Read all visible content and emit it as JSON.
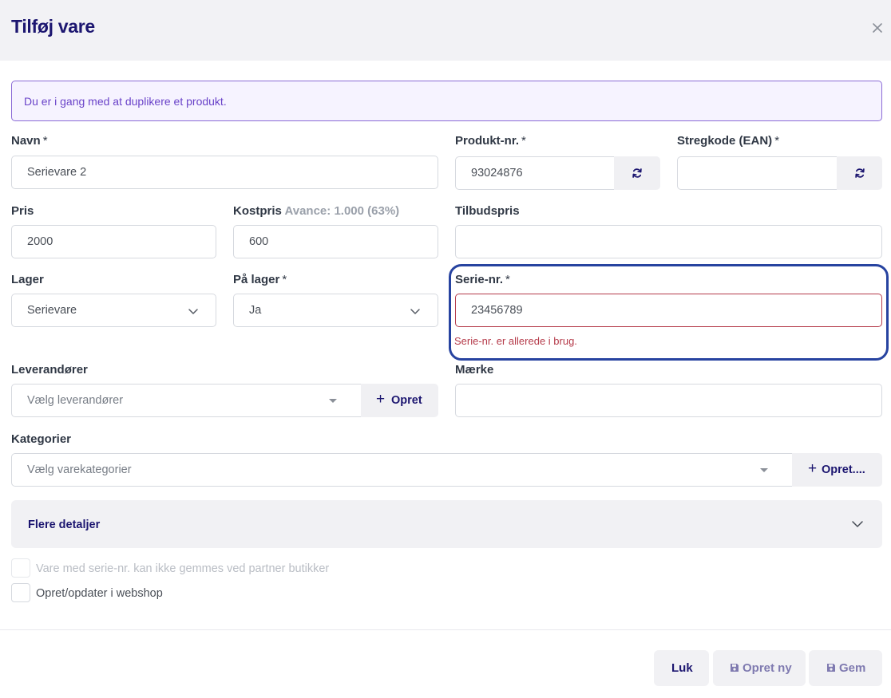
{
  "header": {
    "title": "Tilføj vare",
    "close_icon": "close-icon"
  },
  "banner": {
    "text": "Du er i gang med at duplikere et produkt."
  },
  "fields": {
    "navn": {
      "label": "Navn",
      "required": "*",
      "value": "Serievare 2"
    },
    "produkt_nr": {
      "label": "Produkt-nr.",
      "required": "*",
      "value": "93024876",
      "icon": "refresh-icon"
    },
    "stregkode": {
      "label": "Stregkode (EAN)",
      "required": "*",
      "value": "",
      "icon": "refresh-icon"
    },
    "pris": {
      "label": "Pris",
      "value": "2000"
    },
    "kostpris": {
      "label": "Kostpris",
      "hint": "Avance: 1.000 (63%)",
      "value": "600"
    },
    "tilbudspris": {
      "label": "Tilbudspris",
      "value": ""
    },
    "lager": {
      "label": "Lager",
      "value": "Serievare"
    },
    "paa_lager": {
      "label": "På lager",
      "required": "*",
      "value": "Ja"
    },
    "serie_nr": {
      "label": "Serie-nr.",
      "required": "*",
      "value": "23456789",
      "error": "Serie-nr. er allerede i brug."
    },
    "leverandoerer": {
      "label": "Leverandører",
      "placeholder": "Vælg leverandører",
      "button": "Opret"
    },
    "maerke": {
      "label": "Mærke",
      "value": ""
    },
    "kategorier": {
      "label": "Kategorier",
      "placeholder": "Vælg varekategorier",
      "button": "Opret...."
    }
  },
  "details": {
    "label": "Flere detaljer"
  },
  "checkboxes": {
    "serie_partner": {
      "label": "Vare med serie-nr. kan ikke gemmes ved partner butikker",
      "checked": false,
      "disabled": true
    },
    "webshop": {
      "label": "Opret/opdater i webshop",
      "checked": false,
      "disabled": false
    }
  },
  "footer": {
    "luk": "Luk",
    "opret_ny": "Opret ny",
    "gem": "Gem"
  },
  "colors": {
    "brand": "#1c1670",
    "error": "#b53b4a",
    "highlight": "#2743a0",
    "banner_text": "#6a43c9"
  }
}
